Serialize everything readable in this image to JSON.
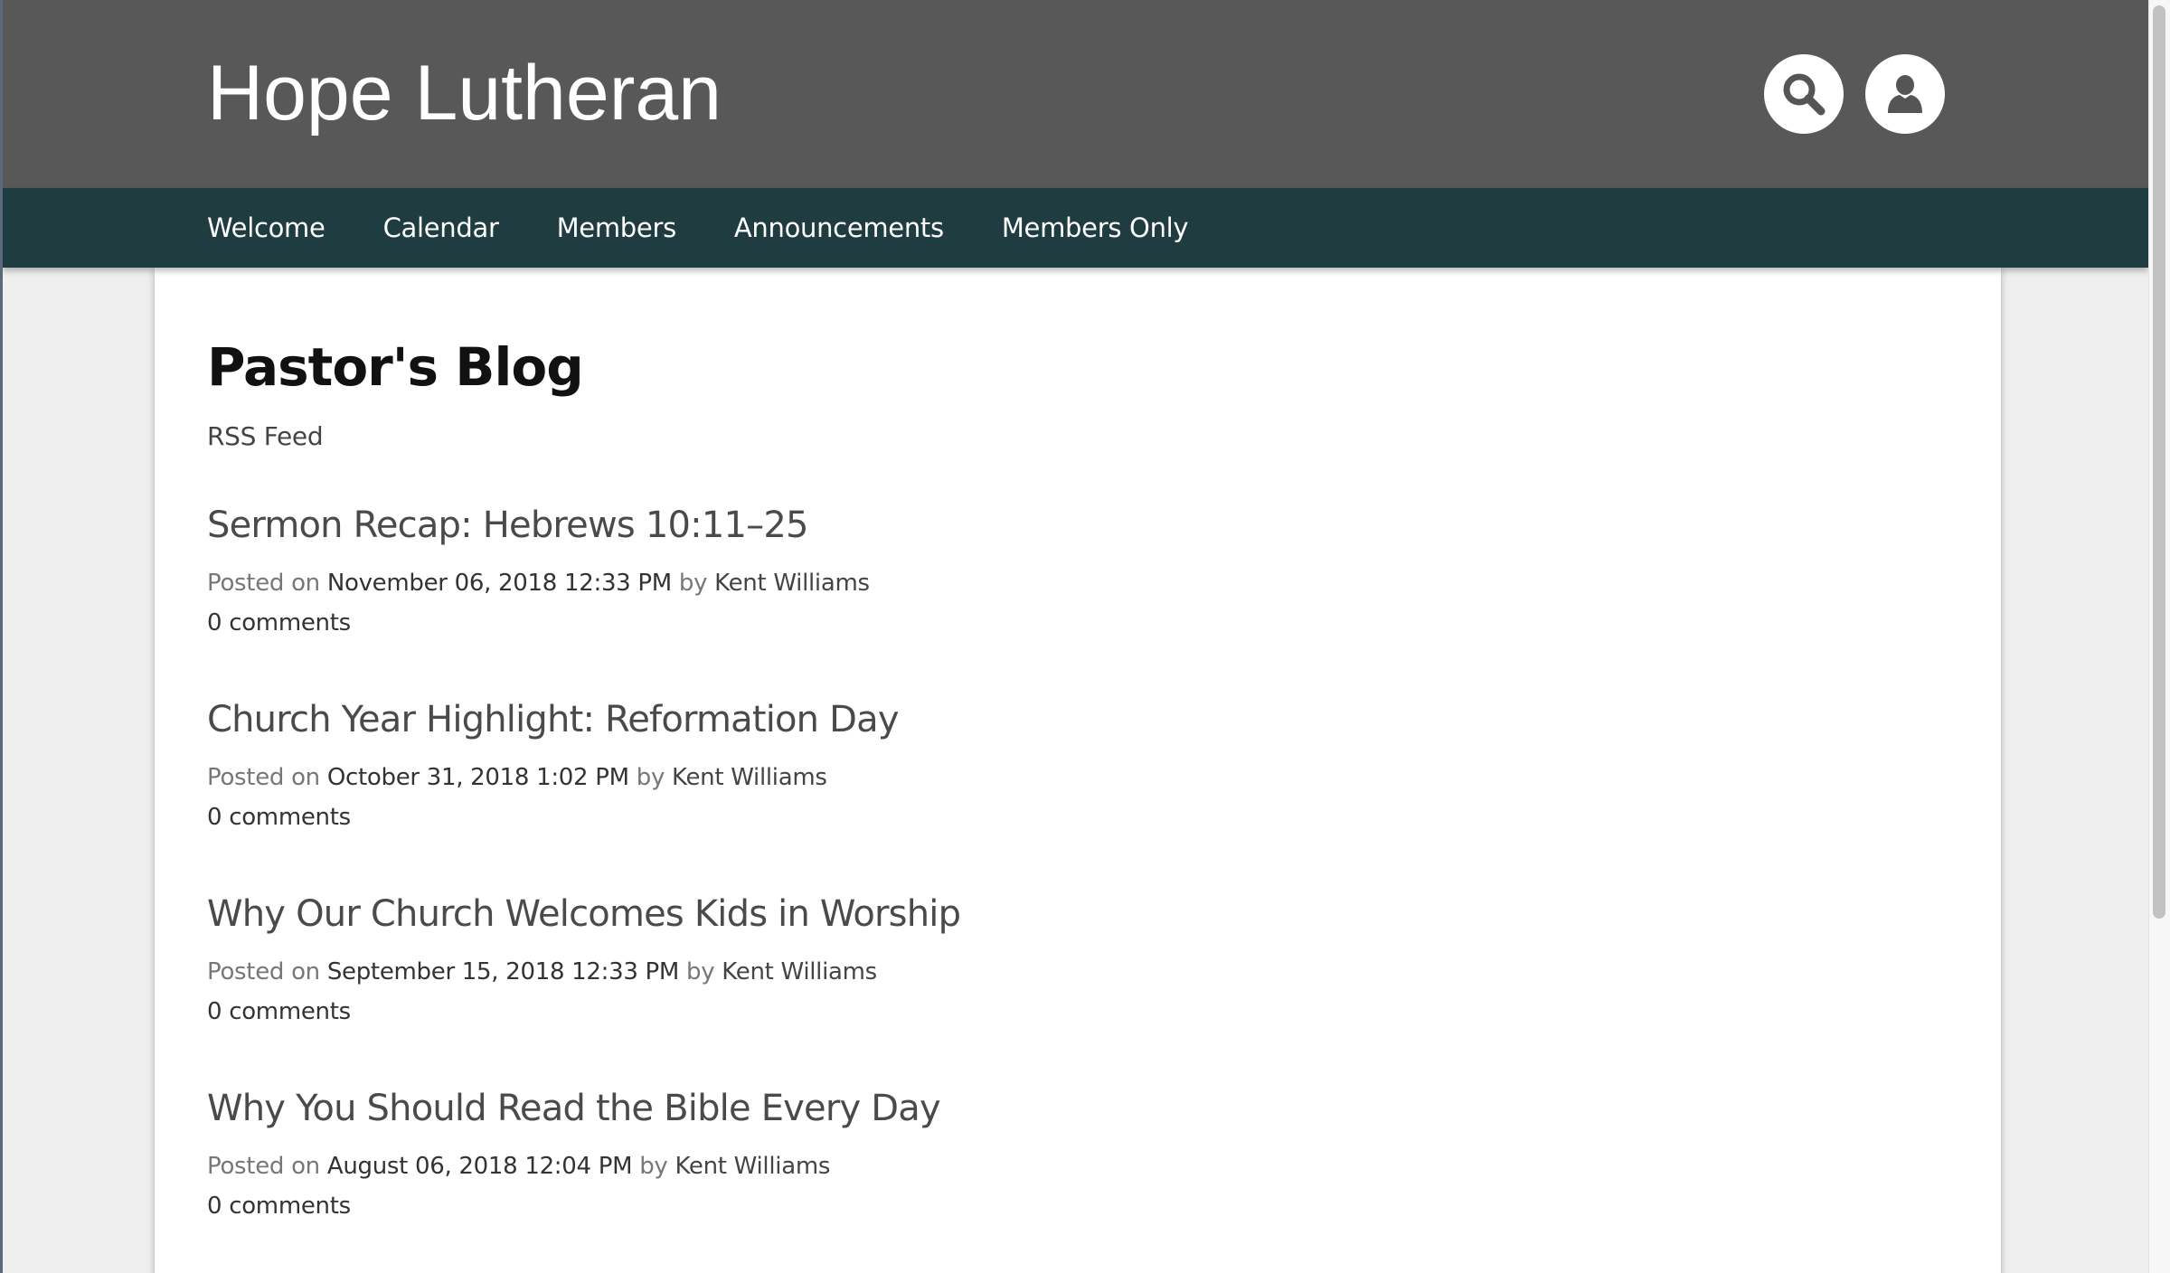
{
  "header": {
    "site_title": "Hope Lutheran",
    "search_icon": "search-icon",
    "user_icon": "user-icon"
  },
  "nav": {
    "items": [
      {
        "label": "Welcome"
      },
      {
        "label": "Calendar"
      },
      {
        "label": "Members"
      },
      {
        "label": "Announcements"
      },
      {
        "label": "Members Only"
      }
    ]
  },
  "main": {
    "title": "Pastor's Blog",
    "rss_label": "RSS Feed",
    "posts": [
      {
        "title": "Sermon Recap: Hebrews 10:11–25",
        "posted_on_label": "Posted on",
        "date": "November 06, 2018 12:33 PM",
        "by_label": "by",
        "author": "Kent Williams",
        "comments": "0 comments"
      },
      {
        "title": "Church Year Highlight: Reformation Day",
        "posted_on_label": "Posted on",
        "date": "October 31, 2018 1:02 PM",
        "by_label": "by",
        "author": "Kent Williams",
        "comments": "0 comments"
      },
      {
        "title": "Why Our Church Welcomes Kids in Worship",
        "posted_on_label": "Posted on",
        "date": "September 15, 2018 12:33 PM",
        "by_label": "by",
        "author": "Kent Williams",
        "comments": "0 comments"
      },
      {
        "title": "Why You Should Read the Bible Every Day",
        "posted_on_label": "Posted on",
        "date": "August 06, 2018 12:04 PM",
        "by_label": "by",
        "author": "Kent Williams",
        "comments": "0 comments"
      }
    ]
  },
  "colors": {
    "header_bg": "#585858",
    "nav_bg": "#1f3c41",
    "card_bg": "#ffffff",
    "page_bg": "#efefef"
  }
}
